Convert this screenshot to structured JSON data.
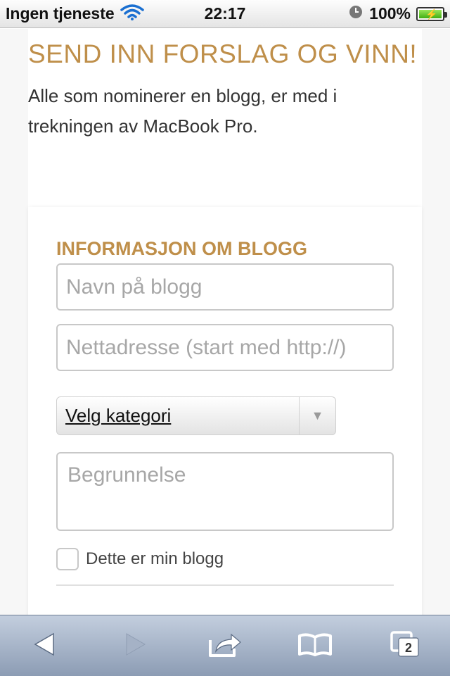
{
  "status_bar": {
    "carrier": "Ingen tjeneste",
    "time": "22:17",
    "battery": "100%"
  },
  "intro": {
    "headline": "SEND INN FORSLAG OG VINN!",
    "lead": "Alle som nominerer en blogg, er med i trekningen av MacBook Pro."
  },
  "form": {
    "section_title": "INFORMASJON OM BLOGG",
    "name_placeholder": "Navn på blogg",
    "url_placeholder": "Nettadresse (start med http://)",
    "category_value": "Velg kategori",
    "reason_placeholder": "Begrunnelse",
    "own_blog_label": "Dette er min blogg"
  },
  "toolbar": {
    "tabs_count": "2",
    "icons": [
      "back-icon",
      "forward-icon",
      "share-icon",
      "bookmarks-icon",
      "tabs-icon"
    ]
  },
  "colors": {
    "accent": "#bf8f4a",
    "toolbar_top": "#c3cede",
    "toolbar_bottom": "#8c9cb4"
  }
}
